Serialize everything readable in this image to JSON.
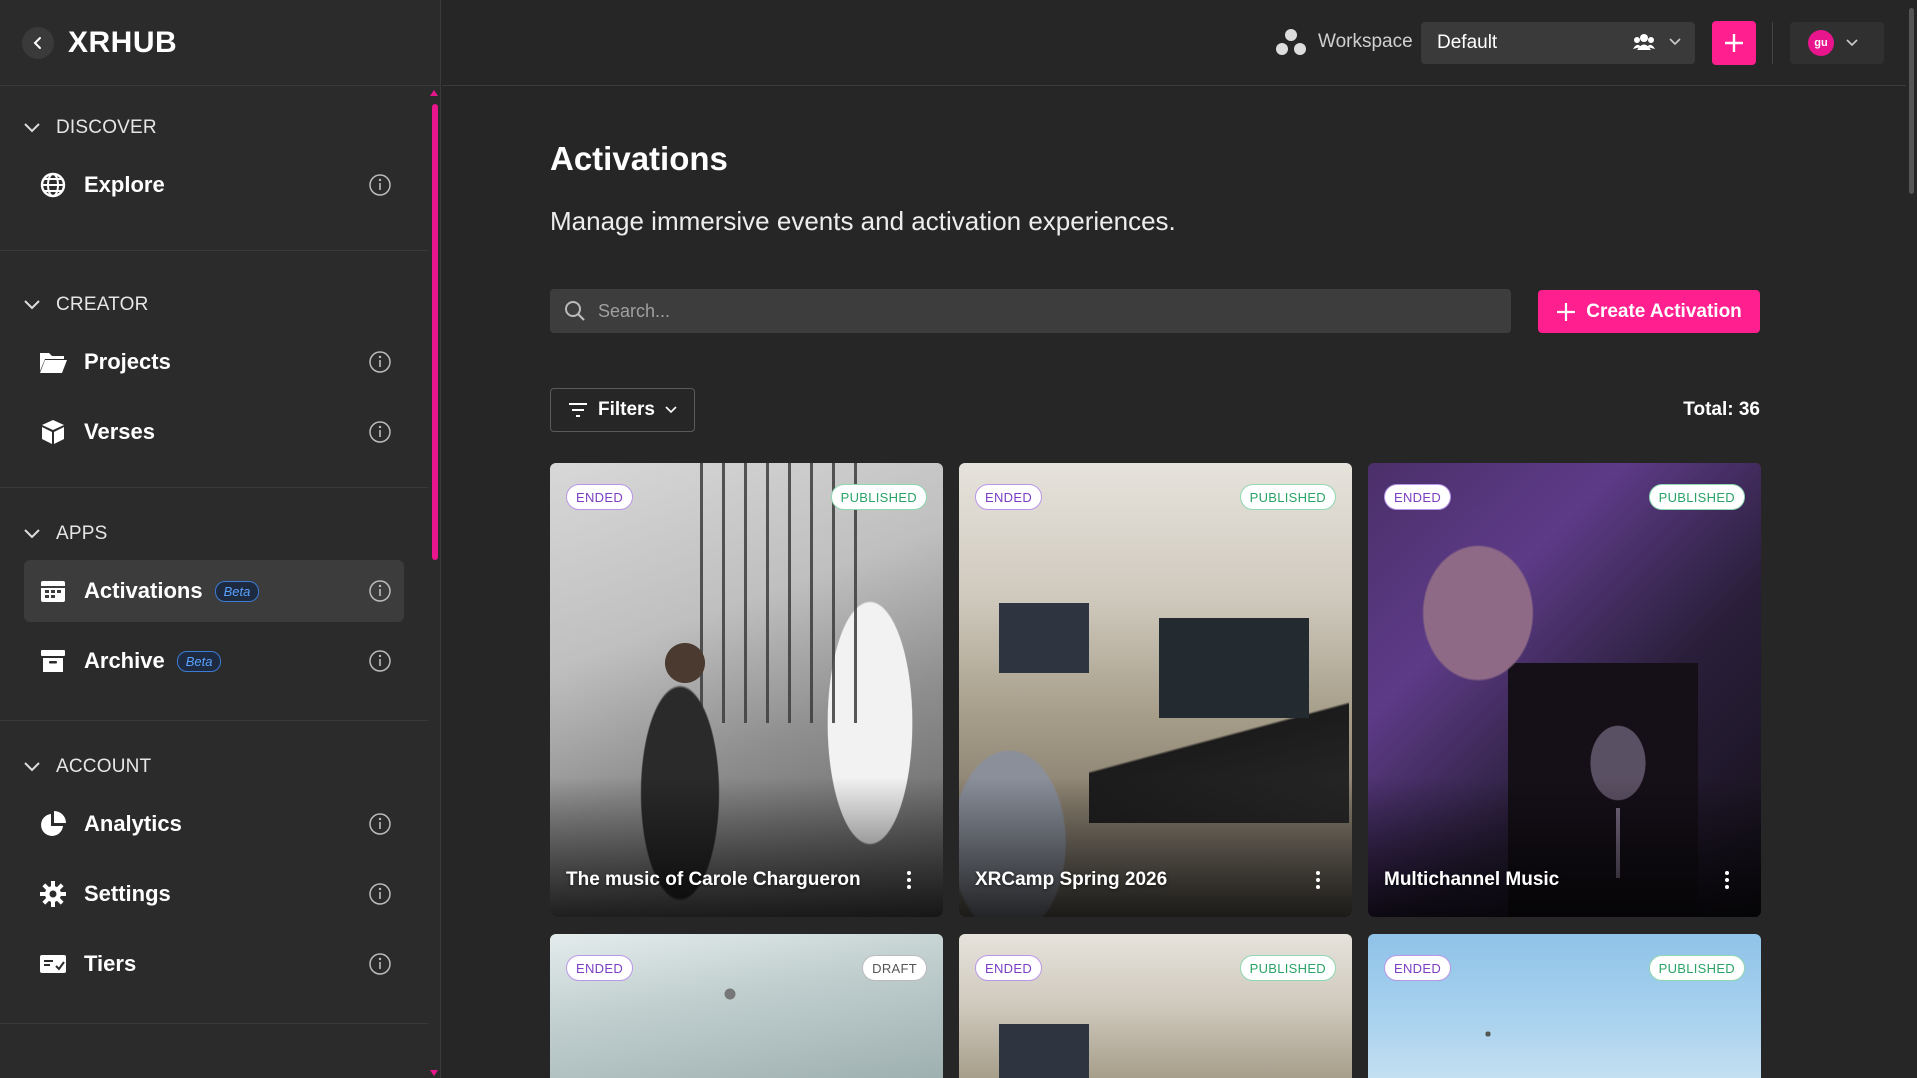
{
  "app": {
    "title": "XRHUB"
  },
  "sidebar": {
    "sections": [
      {
        "heading": "DISCOVER",
        "items": [
          {
            "label": "Explore",
            "icon": "globe-icon"
          }
        ]
      },
      {
        "heading": "CREATOR",
        "items": [
          {
            "label": "Projects",
            "icon": "folder-icon"
          },
          {
            "label": "Verses",
            "icon": "cube-icon"
          }
        ]
      },
      {
        "heading": "APPS",
        "items": [
          {
            "label": "Activations",
            "icon": "calendar-icon",
            "badge": "Beta",
            "active": true
          },
          {
            "label": "Archive",
            "icon": "archive-icon",
            "badge": "Beta"
          }
        ]
      },
      {
        "heading": "ACCOUNT",
        "items": [
          {
            "label": "Analytics",
            "icon": "pie-chart-icon"
          },
          {
            "label": "Settings",
            "icon": "gear-icon"
          },
          {
            "label": "Tiers",
            "icon": "ticket-icon"
          }
        ]
      }
    ]
  },
  "topbar": {
    "workspace_label": "Workspace",
    "workspace_value": "Default",
    "avatar_initials": "gu"
  },
  "main": {
    "title": "Activations",
    "subtitle": "Manage immersive events and activation experiences.",
    "search_placeholder": "Search...",
    "create_label": "Create Activation",
    "filters_label": "Filters",
    "total_label": "Total: 36"
  },
  "cards": [
    {
      "title": "The music of Carole Chargueron",
      "status": "ENDED",
      "state": "PUBLISHED"
    },
    {
      "title": "XRCamp Spring 2026",
      "status": "ENDED",
      "state": "PUBLISHED"
    },
    {
      "title": "Multichannel Music",
      "status": "ENDED",
      "state": "PUBLISHED"
    },
    {
      "title": "",
      "status": "ENDED",
      "state": "DRAFT"
    },
    {
      "title": "",
      "status": "ENDED",
      "state": "PUBLISHED"
    },
    {
      "title": "",
      "status": "ENDED",
      "state": "PUBLISHED"
    }
  ],
  "colors": {
    "accent": "#ff1f8e",
    "background": "#262626",
    "sidebar": "#2b2b2b"
  }
}
